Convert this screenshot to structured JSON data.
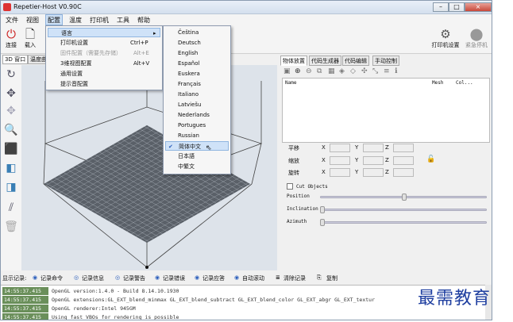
{
  "window": {
    "title": "Repetier-Host V0.90C",
    "min": "–",
    "max": "□",
    "close": "×"
  },
  "menubar": [
    "文件",
    "视图",
    "配置",
    "温度",
    "打印机",
    "工具",
    "帮助"
  ],
  "toolbar": {
    "connect": "连接",
    "load": "载入",
    "printer_settings": "打印机设置",
    "emergency_stop": "紧急停机"
  },
  "left_tabs": [
    "3D 窗口",
    "温度曲"
  ],
  "right_tabs": [
    "物体放置",
    "代码生成器",
    "代码编辑",
    "手动控制"
  ],
  "object_table": {
    "col_name": "Name",
    "col_mesh": "Mesh",
    "col_col": "Col..."
  },
  "transform": {
    "translate": "平移",
    "scale": "缩放",
    "rotate": "旋转",
    "x": "X",
    "y": "Y",
    "z": "Z"
  },
  "cut": {
    "label": "Cut Objects",
    "position": "Position",
    "inclination": "Inclination",
    "azimuth": "Azimuth"
  },
  "config_menu": {
    "items": [
      {
        "label": "语言",
        "shortcut": "",
        "disabled": false,
        "highlight": true,
        "arrow": "▸"
      },
      {
        "label": "打印机设置",
        "shortcut": "Ctrl+P",
        "disabled": false
      },
      {
        "label": "固件配置（需要先存储）",
        "shortcut": "Alt+E",
        "disabled": true
      },
      {
        "label": "3维视图配置",
        "shortcut": "Alt+V",
        "disabled": false
      },
      {
        "label": "通用设置",
        "shortcut": "",
        "disabled": false
      },
      {
        "label": "提示音配置",
        "shortcut": "",
        "disabled": false
      }
    ]
  },
  "language_menu": {
    "items": [
      "Čeština",
      "Deutsch",
      "English",
      "Español",
      "Euskera",
      "Français",
      "Italiano",
      "Latviešu",
      "Nederlands",
      "Portugues",
      "Russian",
      "简体中文",
      "日本語",
      "中繁文"
    ],
    "selected": "简体中文",
    "check": "✔"
  },
  "log_toolbar": {
    "label": "显示记录:",
    "items": [
      "记录命令",
      "记录信息",
      "记录警告",
      "记录错误",
      "记录应答",
      "自动滚动",
      "清除记录",
      "复制"
    ]
  },
  "log": [
    {
      "time": "14:55:37.415",
      "msg": "OpenGL version:1.4.0 - Build 8.14.10.1930"
    },
    {
      "time": "14:55:37.415",
      "msg": "OpenGL extensions:GL_EXT_blend_minmax GL_EXT_blend_subtract GL_EXT_blend_color GL_EXT_abgr GL_EXT_textur"
    },
    {
      "time": "14:55:37.415",
      "msg": "OpenGL renderer:Intel 945GM"
    },
    {
      "time": "14:55:37.415",
      "msg": "Using fast VBOs for rendering is possible"
    }
  ],
  "watermark": "最需教育"
}
